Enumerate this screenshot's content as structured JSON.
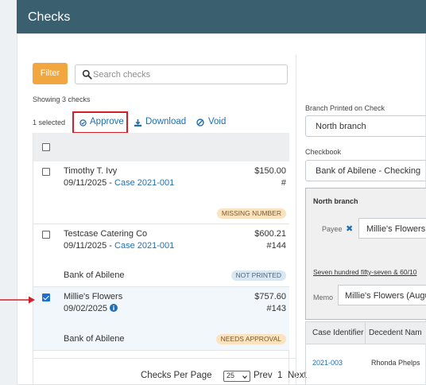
{
  "header": {
    "title": "Checks"
  },
  "toolbar": {
    "filter_label": "Filter",
    "search_placeholder": "Search checks",
    "showing_text": "Showing 3 checks",
    "selected_text": "1 selected",
    "approve_label": "Approve",
    "download_label": "Download",
    "void_label": "Void"
  },
  "checks": [
    {
      "payee": "Timothy T. Ivy",
      "date": "09/11/2025",
      "case": "Case 2021-001",
      "amount": "$150.00",
      "number": "#",
      "bank": "",
      "status": "MISSING NUMBER",
      "checked": false
    },
    {
      "payee": "Testcase Catering Co",
      "date": "09/11/2025",
      "case": "Case 2021-001",
      "amount": "$600.21",
      "number": "#144",
      "bank": "Bank of Abilene",
      "status": "NOT PRINTED",
      "checked": false
    },
    {
      "payee": "Millie's Flowers",
      "date": "09/02/2025",
      "case": "",
      "amount": "$757.60",
      "number": "#143",
      "bank": "Bank of Abilene",
      "status": "NEEDS APPROVAL",
      "checked": true
    }
  ],
  "pager": {
    "label": "Checks Per Page",
    "per_page": "25",
    "prev": "Prev",
    "page": "1",
    "next": "Next"
  },
  "detail": {
    "branch_label": "Branch Printed on Check",
    "branch_value": "North branch",
    "checkbook_label": "Checkbook",
    "checkbook_value": "Bank of Abilene - Checking",
    "preview_branch": "North branch",
    "payee_label": "Payee",
    "payee_value": "Millie's Flowers",
    "amount_words": "Seven hundred fifty-seven & 60/10",
    "memo_label": "Memo",
    "memo_value": "Millie's Flowers (Augu",
    "table_headers": [
      "Case Identifier",
      "Decedent Nam"
    ],
    "table_rows": [
      {
        "case_id": "2021-003",
        "decedent": "Rhonda Phelps"
      }
    ]
  },
  "colors": {
    "header_bg": "#3a6070",
    "accent": "#f1a640",
    "link": "#1f6fb2",
    "highlight": "#d0202a"
  }
}
